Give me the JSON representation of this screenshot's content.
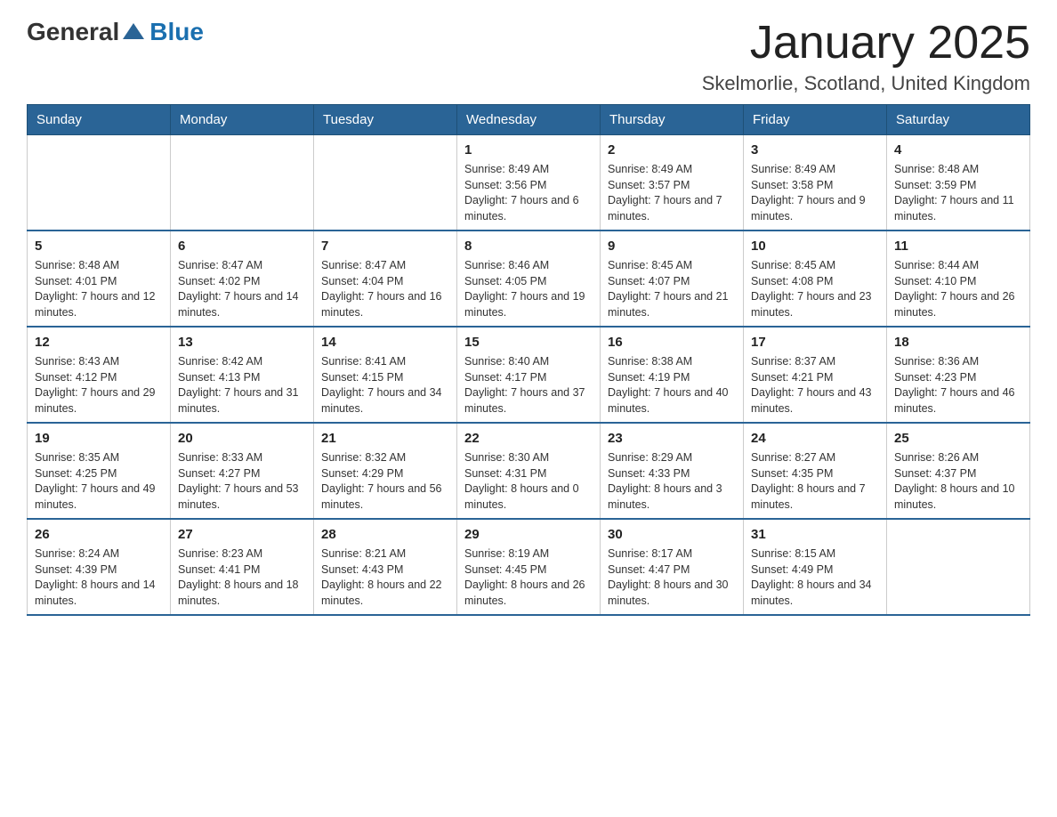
{
  "logo": {
    "text_general": "General",
    "text_blue": "Blue"
  },
  "title": "January 2025",
  "subtitle": "Skelmorlie, Scotland, United Kingdom",
  "header_days": [
    "Sunday",
    "Monday",
    "Tuesday",
    "Wednesday",
    "Thursday",
    "Friday",
    "Saturday"
  ],
  "weeks": [
    [
      {
        "day": "",
        "info": ""
      },
      {
        "day": "",
        "info": ""
      },
      {
        "day": "",
        "info": ""
      },
      {
        "day": "1",
        "info": "Sunrise: 8:49 AM\nSunset: 3:56 PM\nDaylight: 7 hours and 6 minutes."
      },
      {
        "day": "2",
        "info": "Sunrise: 8:49 AM\nSunset: 3:57 PM\nDaylight: 7 hours and 7 minutes."
      },
      {
        "day": "3",
        "info": "Sunrise: 8:49 AM\nSunset: 3:58 PM\nDaylight: 7 hours and 9 minutes."
      },
      {
        "day": "4",
        "info": "Sunrise: 8:48 AM\nSunset: 3:59 PM\nDaylight: 7 hours and 11 minutes."
      }
    ],
    [
      {
        "day": "5",
        "info": "Sunrise: 8:48 AM\nSunset: 4:01 PM\nDaylight: 7 hours and 12 minutes."
      },
      {
        "day": "6",
        "info": "Sunrise: 8:47 AM\nSunset: 4:02 PM\nDaylight: 7 hours and 14 minutes."
      },
      {
        "day": "7",
        "info": "Sunrise: 8:47 AM\nSunset: 4:04 PM\nDaylight: 7 hours and 16 minutes."
      },
      {
        "day": "8",
        "info": "Sunrise: 8:46 AM\nSunset: 4:05 PM\nDaylight: 7 hours and 19 minutes."
      },
      {
        "day": "9",
        "info": "Sunrise: 8:45 AM\nSunset: 4:07 PM\nDaylight: 7 hours and 21 minutes."
      },
      {
        "day": "10",
        "info": "Sunrise: 8:45 AM\nSunset: 4:08 PM\nDaylight: 7 hours and 23 minutes."
      },
      {
        "day": "11",
        "info": "Sunrise: 8:44 AM\nSunset: 4:10 PM\nDaylight: 7 hours and 26 minutes."
      }
    ],
    [
      {
        "day": "12",
        "info": "Sunrise: 8:43 AM\nSunset: 4:12 PM\nDaylight: 7 hours and 29 minutes."
      },
      {
        "day": "13",
        "info": "Sunrise: 8:42 AM\nSunset: 4:13 PM\nDaylight: 7 hours and 31 minutes."
      },
      {
        "day": "14",
        "info": "Sunrise: 8:41 AM\nSunset: 4:15 PM\nDaylight: 7 hours and 34 minutes."
      },
      {
        "day": "15",
        "info": "Sunrise: 8:40 AM\nSunset: 4:17 PM\nDaylight: 7 hours and 37 minutes."
      },
      {
        "day": "16",
        "info": "Sunrise: 8:38 AM\nSunset: 4:19 PM\nDaylight: 7 hours and 40 minutes."
      },
      {
        "day": "17",
        "info": "Sunrise: 8:37 AM\nSunset: 4:21 PM\nDaylight: 7 hours and 43 minutes."
      },
      {
        "day": "18",
        "info": "Sunrise: 8:36 AM\nSunset: 4:23 PM\nDaylight: 7 hours and 46 minutes."
      }
    ],
    [
      {
        "day": "19",
        "info": "Sunrise: 8:35 AM\nSunset: 4:25 PM\nDaylight: 7 hours and 49 minutes."
      },
      {
        "day": "20",
        "info": "Sunrise: 8:33 AM\nSunset: 4:27 PM\nDaylight: 7 hours and 53 minutes."
      },
      {
        "day": "21",
        "info": "Sunrise: 8:32 AM\nSunset: 4:29 PM\nDaylight: 7 hours and 56 minutes."
      },
      {
        "day": "22",
        "info": "Sunrise: 8:30 AM\nSunset: 4:31 PM\nDaylight: 8 hours and 0 minutes."
      },
      {
        "day": "23",
        "info": "Sunrise: 8:29 AM\nSunset: 4:33 PM\nDaylight: 8 hours and 3 minutes."
      },
      {
        "day": "24",
        "info": "Sunrise: 8:27 AM\nSunset: 4:35 PM\nDaylight: 8 hours and 7 minutes."
      },
      {
        "day": "25",
        "info": "Sunrise: 8:26 AM\nSunset: 4:37 PM\nDaylight: 8 hours and 10 minutes."
      }
    ],
    [
      {
        "day": "26",
        "info": "Sunrise: 8:24 AM\nSunset: 4:39 PM\nDaylight: 8 hours and 14 minutes."
      },
      {
        "day": "27",
        "info": "Sunrise: 8:23 AM\nSunset: 4:41 PM\nDaylight: 8 hours and 18 minutes."
      },
      {
        "day": "28",
        "info": "Sunrise: 8:21 AM\nSunset: 4:43 PM\nDaylight: 8 hours and 22 minutes."
      },
      {
        "day": "29",
        "info": "Sunrise: 8:19 AM\nSunset: 4:45 PM\nDaylight: 8 hours and 26 minutes."
      },
      {
        "day": "30",
        "info": "Sunrise: 8:17 AM\nSunset: 4:47 PM\nDaylight: 8 hours and 30 minutes."
      },
      {
        "day": "31",
        "info": "Sunrise: 8:15 AM\nSunset: 4:49 PM\nDaylight: 8 hours and 34 minutes."
      },
      {
        "day": "",
        "info": ""
      }
    ]
  ]
}
